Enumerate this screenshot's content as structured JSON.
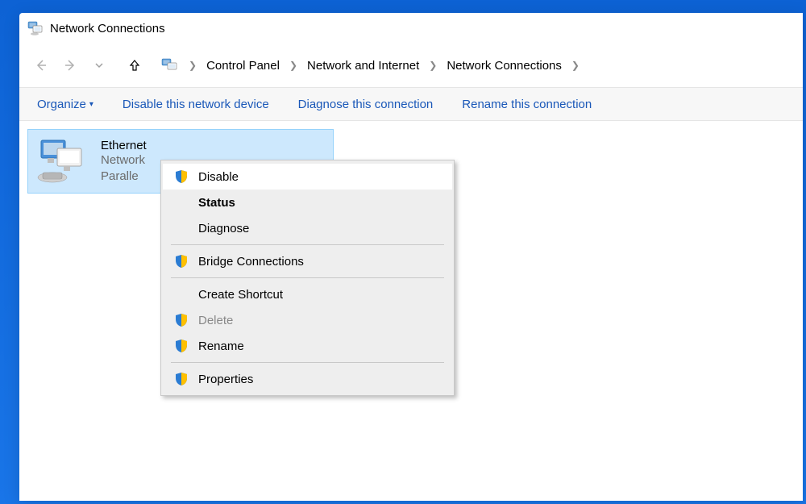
{
  "titlebar": {
    "title": "Network Connections"
  },
  "breadcrumb": {
    "items": [
      "Control Panel",
      "Network and Internet",
      "Network Connections"
    ]
  },
  "toolbar": {
    "organize": "Organize",
    "disable": "Disable this network device",
    "diagnose": "Diagnose this connection",
    "rename": "Rename this connection"
  },
  "tile": {
    "name": "Ethernet",
    "status": "Network",
    "adapter": "Paralle"
  },
  "menu": {
    "disable": "Disable",
    "status": "Status",
    "diagnose": "Diagnose",
    "bridge": "Bridge Connections",
    "shortcut": "Create Shortcut",
    "delete": "Delete",
    "rename": "Rename",
    "properties": "Properties"
  }
}
